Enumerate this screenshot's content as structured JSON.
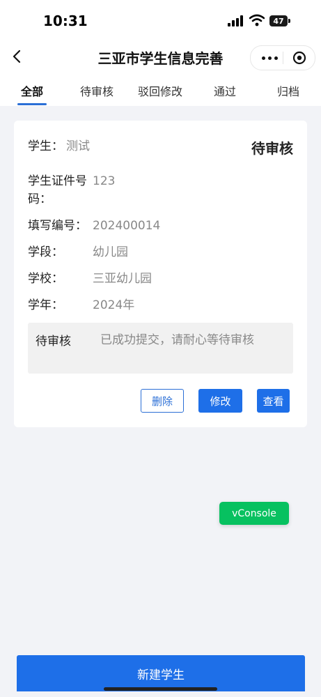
{
  "status_bar": {
    "time": "10:31",
    "battery": "47"
  },
  "nav": {
    "title": "三亚市学生信息完善"
  },
  "tabs": [
    {
      "label": "全部",
      "active": true
    },
    {
      "label": "待审核",
      "active": false
    },
    {
      "label": "驳回修改",
      "active": false
    },
    {
      "label": "通过",
      "active": false
    },
    {
      "label": "归档",
      "active": false
    }
  ],
  "record": {
    "student_label": "学生：",
    "student_value": "测试",
    "status": "待审核",
    "id_label_line1": "学生证件号",
    "id_label_line2": "码：",
    "id_value": "123",
    "form_no_label": "填写编号：",
    "form_no_value": "202400014",
    "stage_label": "学段：",
    "stage_value": "幼儿园",
    "school_label": "学校：",
    "school_value": "三亚幼儿园",
    "year_label": "学年：",
    "year_value": "2024年",
    "notice_status": "待审核",
    "notice_message": "已成功提交，请耐心等待审核",
    "buttons": {
      "delete": "删除",
      "edit": "修改",
      "view": "查看"
    }
  },
  "vconsole_label": "vConsole",
  "footer": {
    "new_student": "新建学生"
  },
  "colors": {
    "accent": "#1e6fe8",
    "vconsole": "#07c160",
    "background": "#f2f3f7"
  }
}
